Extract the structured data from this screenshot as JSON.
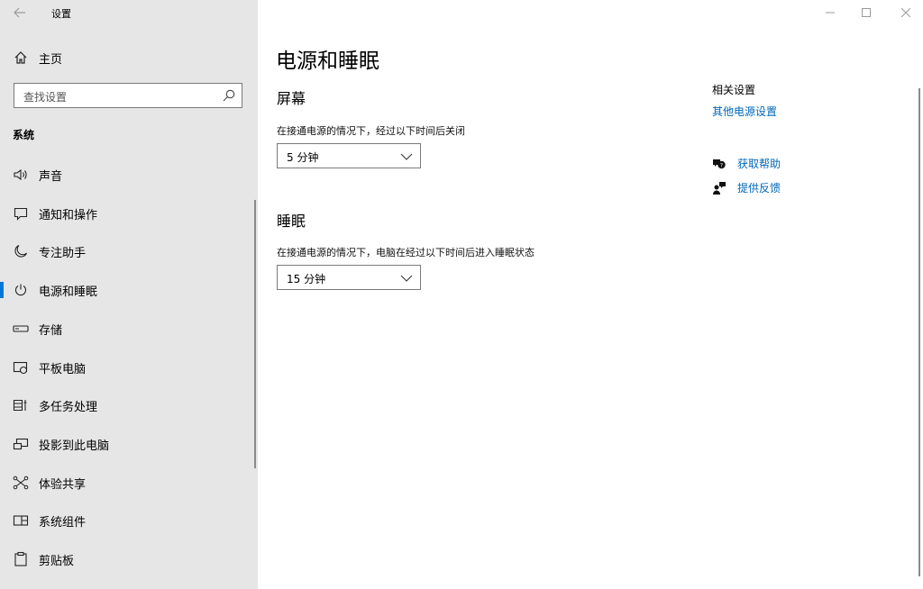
{
  "window": {
    "app_title": "设置",
    "controls": {
      "minimize": "—",
      "maximize": "☐",
      "close": "✕"
    }
  },
  "sidebar": {
    "home_label": "主页",
    "search_placeholder": "查找设置",
    "section_header": "系统",
    "items": [
      {
        "label": "声音",
        "icon": "speaker-icon"
      },
      {
        "label": "通知和操作",
        "icon": "message-icon"
      },
      {
        "label": "专注助手",
        "icon": "moon-icon"
      },
      {
        "label": "电源和睡眠",
        "icon": "power-icon",
        "active": true
      },
      {
        "label": "存储",
        "icon": "storage-icon"
      },
      {
        "label": "平板电脑",
        "icon": "tablet-icon"
      },
      {
        "label": "多任务处理",
        "icon": "multitask-icon"
      },
      {
        "label": "投影到此电脑",
        "icon": "project-icon"
      },
      {
        "label": "体验共享",
        "icon": "share-icon"
      },
      {
        "label": "系统组件",
        "icon": "components-icon"
      },
      {
        "label": "剪贴板",
        "icon": "clipboard-icon"
      }
    ],
    "accent_color": "#0078d7"
  },
  "main": {
    "page_title": "电源和睡眠",
    "screen": {
      "title": "屏幕",
      "label": "在接通电源的情况下，经过以下时间后关闭",
      "value": "5 分钟"
    },
    "sleep": {
      "title": "睡眠",
      "label": "在接通电源的情况下，电脑在经过以下时间后进入睡眠状态",
      "value": "15 分钟"
    }
  },
  "related": {
    "title": "相关设置",
    "other_power_link": "其他电源设置",
    "get_help": "获取帮助",
    "feedback": "提供反馈",
    "link_color": "#0067b8"
  }
}
